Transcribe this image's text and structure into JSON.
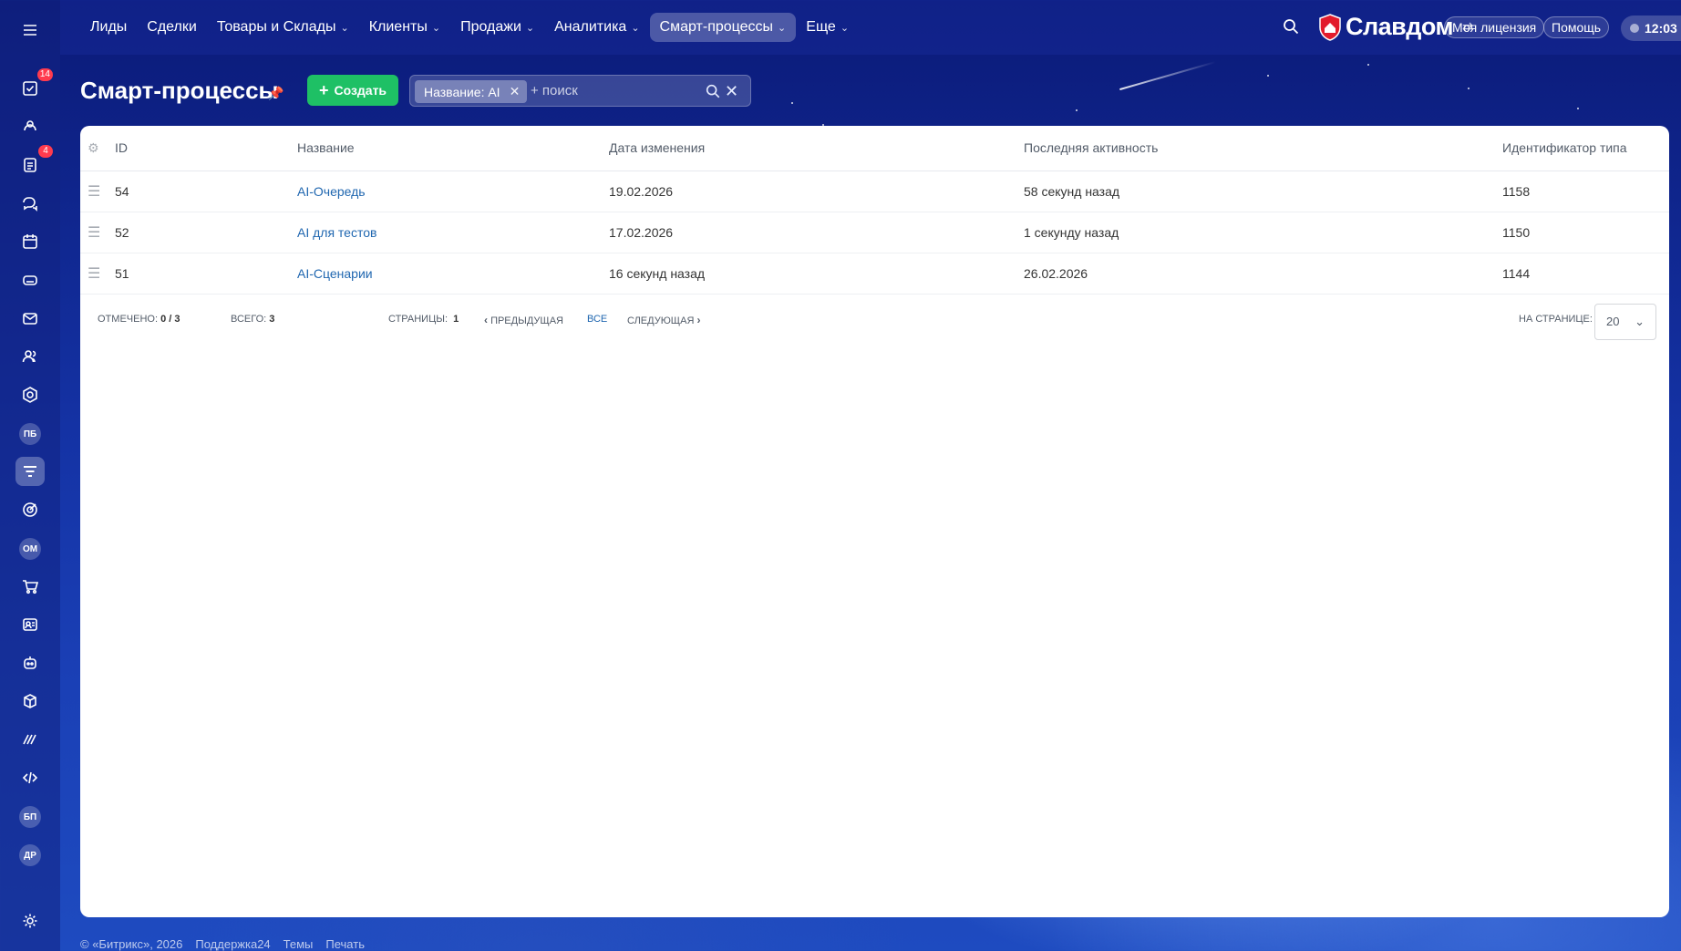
{
  "colors": {
    "accent_green": "#1ec065",
    "link": "#2067b0",
    "badge": "#ff3b4e"
  },
  "sidebar": {
    "items": [
      {
        "icon": "menu-icon"
      },
      {
        "icon": "tasks-icon",
        "badge": "14"
      },
      {
        "icon": "feed-icon"
      },
      {
        "icon": "document-icon",
        "badge": "4"
      },
      {
        "icon": "chat-icon"
      },
      {
        "icon": "calendar-icon"
      },
      {
        "icon": "drive-icon"
      },
      {
        "icon": "mail-icon"
      },
      {
        "icon": "users-icon"
      },
      {
        "icon": "hexagon-icon"
      },
      {
        "abbr": "ПБ"
      },
      {
        "icon": "funnel-icon"
      },
      {
        "icon": "target-icon"
      },
      {
        "abbr": "ОМ"
      },
      {
        "icon": "cart-icon"
      },
      {
        "icon": "contact-card-icon"
      },
      {
        "icon": "robot-icon"
      },
      {
        "icon": "box-icon"
      },
      {
        "icon": "marks-icon"
      },
      {
        "icon": "code-icon"
      },
      {
        "abbr": "БП"
      },
      {
        "abbr": "ДР"
      },
      {
        "icon": "gear-icon"
      }
    ]
  },
  "topnav": {
    "items": [
      {
        "label": "Лиды",
        "dropdown": false
      },
      {
        "label": "Сделки",
        "dropdown": false
      },
      {
        "label": "Товары и Склады",
        "dropdown": true
      },
      {
        "label": "Клиенты",
        "dropdown": true
      },
      {
        "label": "Продажи",
        "dropdown": true
      },
      {
        "label": "Аналитика",
        "dropdown": true
      },
      {
        "label": "Смарт-процессы",
        "dropdown": true,
        "active": true
      },
      {
        "label": "Еще",
        "dropdown": true
      }
    ],
    "brand": "Славдом",
    "license_label": "Моя лицензия",
    "help_label": "Помощь",
    "time": "12:03"
  },
  "header": {
    "title": "Смарт-процессы",
    "create_label": "Создать",
    "filter_tag": "Название: AI",
    "search_placeholder": "+ поиск"
  },
  "grid": {
    "columns": [
      "ID",
      "Название",
      "Дата изменения",
      "Последняя активность",
      "Идентификатор типа"
    ],
    "rows": [
      {
        "id": "54",
        "name": "AI-Очередь",
        "modified": "19.02.2026",
        "activity": "58 секунд назад",
        "type_id": "1158"
      },
      {
        "id": "52",
        "name": "AI для тестов",
        "modified": "17.02.2026",
        "activity": "1 секунду назад",
        "type_id": "1150"
      },
      {
        "id": "51",
        "name": "AI-Сценарии",
        "modified": "16 секунд назад",
        "activity": "26.02.2026",
        "type_id": "1144"
      }
    ],
    "footer": {
      "selected_label": "ОТМЕЧЕНО:",
      "selected_value": "0 / 3",
      "total_label": "ВСЕГО:",
      "total_value": "3",
      "pages_label": "СТРАНИЦЫ:",
      "pages_value": "1",
      "prev_label": "ПРЕДЫДУЩАЯ",
      "all_label": "ВСЕ",
      "next_label": "СЛЕДУЮЩАЯ",
      "per_page_label": "НА СТРАНИЦЕ:",
      "per_page_value": "20"
    }
  },
  "page_footer": {
    "copyright": "© «Битрикс», 2026",
    "links": [
      "Поддержка24",
      "Темы",
      "Печать"
    ]
  }
}
